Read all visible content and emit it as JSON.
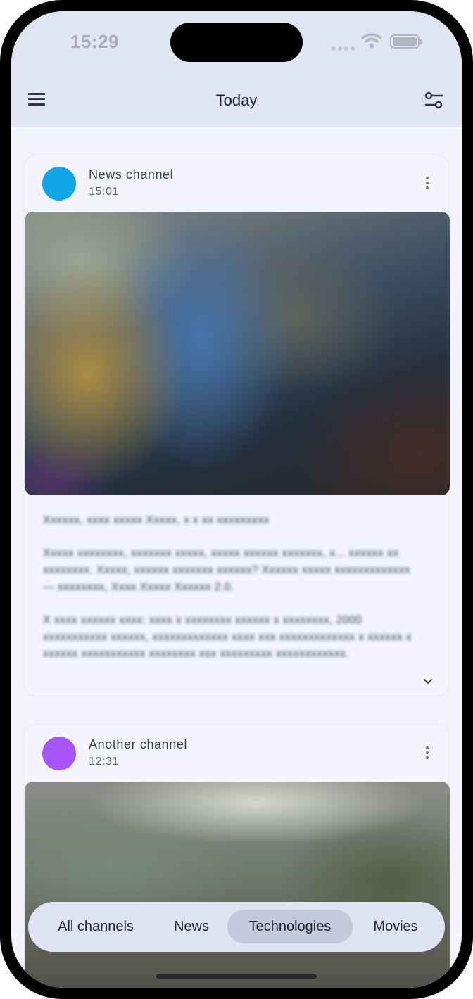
{
  "status_bar": {
    "time": "15:29"
  },
  "app_bar": {
    "title": "Today"
  },
  "posts": [
    {
      "channel": "News channel",
      "time": "15:01",
      "avatar_color": "#0ea5e9",
      "paragraphs": [
        "Xxxxxx, xxxx xxxxx Xxxxx, x x xx xxxxxxxxx",
        "Xxxxx xxxxxxxx, xxxxxxx xxxxx, xxxxx xxxxxx xxxxxxx, x... xxxxxx xx xxxxxxxx. Xxxxx, xxxxxx xxxxxxx xxxxxx? Xxxxxx xxxxx xxxxxxxxxxxxx — xxxxxxxx, Xxxx Xxxxx Xxxxxx 2.0.",
        "X xxxx xxxxxx xxxx: xxxx x xxxxxxxx xxxxxx x xxxxxxxx, 2000 xxxxxxxxxxx xxxxxx, xxxxxxxxxxxxx xxxx xxx xxxxxxxxxxxxx x xxxxxx x xxxxxx xxxxxxxxxxx xxxxxxxx xxx xxxxxxxxx xxxxxxxxxxxx."
      ]
    },
    {
      "channel": "Another channel",
      "time": "12:31",
      "avatar_color": "#a855f7"
    }
  ],
  "filter_chips": [
    "All channels",
    "News",
    "Technologies",
    "Movies"
  ],
  "selected_chip": "Technologies",
  "colors": {
    "app_bar_bg": "#e1e6f5",
    "screen_bg": "#f2f3fb",
    "chip_bar_bg": "#dfe4f3",
    "chip_selected_bg": "#c3cade"
  },
  "icons": {
    "menu": "menu-icon",
    "filter": "filter-settings-icon",
    "more": "more-vertical-icon",
    "expand": "chevron-down-icon",
    "wifi": "wifi-icon",
    "battery": "battery-icon",
    "signal": "cellular-signal-icon"
  }
}
